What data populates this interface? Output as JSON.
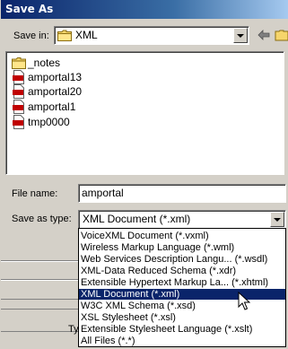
{
  "window": {
    "title": "Save As"
  },
  "save_in": {
    "label": "Save in:",
    "value": "XML"
  },
  "toolbar": {
    "back_icon": "back-arrow-icon",
    "up_icon": "up-folder-icon"
  },
  "files": [
    {
      "name": "_notes",
      "icon": "folder-icon"
    },
    {
      "name": "amportal13",
      "icon": "xml-file-icon"
    },
    {
      "name": "amportal20",
      "icon": "xml-file-icon"
    },
    {
      "name": "amportal1",
      "icon": "xml-file-icon"
    },
    {
      "name": "tmp0000",
      "icon": "xml-file-icon"
    }
  ],
  "file_name": {
    "label": "File name:",
    "value": "amportal"
  },
  "save_as_type": {
    "label": "Save as type:",
    "value": "XML Document (*.xml)",
    "options": [
      "VoiceXML Document (*.vxml)",
      "Wireless Markup Language (*.wml)",
      "Web Services Description Langu... (*.wsdl)",
      "XML-Data Reduced Schema (*.xdr)",
      "Extensible Hypertext Markup La... (*.xhtml)",
      "XML Document (*.xml)",
      "W3C XML Schema (*.xsd)",
      "XSL Stylesheet (*.xsl)",
      "Extensible Stylesheet Language (*.xslt)",
      "All Files (*.*)"
    ],
    "selected_index": 5
  },
  "background_fragment": {
    "text": "Ty"
  },
  "colors": {
    "titlebar": "#0a246a",
    "selection": "#0a246a",
    "face": "#d4d0c8"
  }
}
